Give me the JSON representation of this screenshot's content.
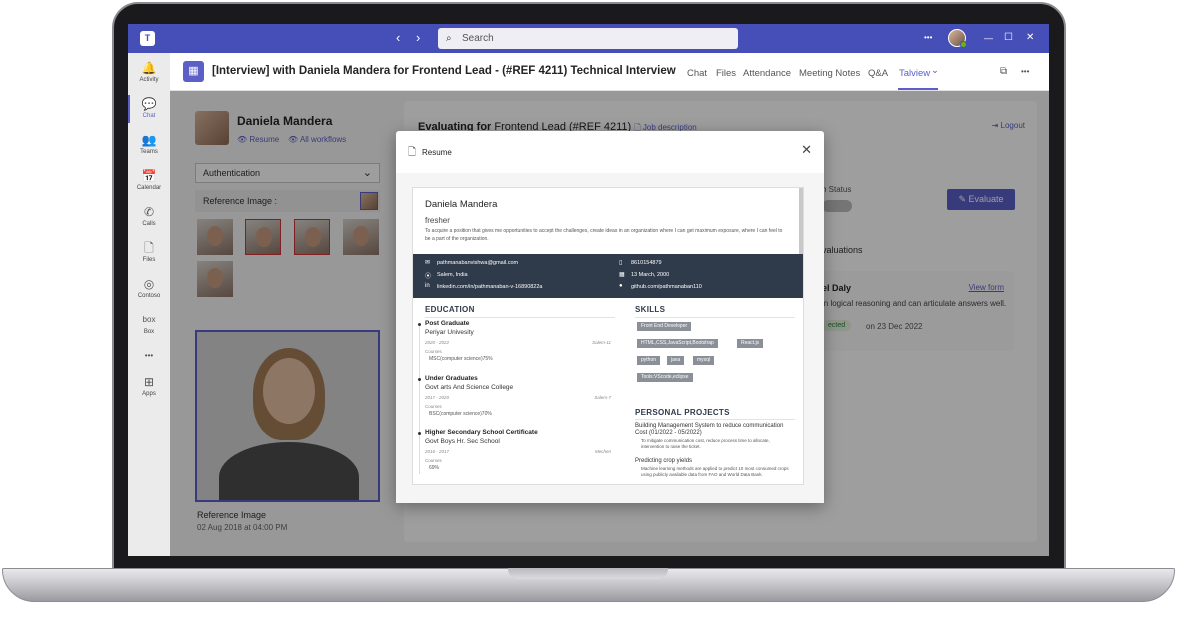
{
  "titlebar": {
    "search_placeholder": "Search",
    "more": "•••",
    "minimize": "—",
    "maximize": "☐",
    "close": "✕"
  },
  "rail": [
    {
      "label": "Activity",
      "icon": "bell-icon",
      "glyph": "🔔"
    },
    {
      "label": "Chat",
      "icon": "chat-icon",
      "glyph": "💬"
    },
    {
      "label": "Teams",
      "icon": "teams-icon",
      "glyph": "👥"
    },
    {
      "label": "Calendar",
      "icon": "calendar-icon",
      "glyph": "📅"
    },
    {
      "label": "Calls",
      "icon": "phone-icon",
      "glyph": "✆"
    },
    {
      "label": "Files",
      "icon": "file-icon",
      "glyph": "🗋"
    },
    {
      "label": "Contoso",
      "icon": "contoso-icon",
      "glyph": "◎"
    },
    {
      "label": "Box",
      "icon": "box-icon",
      "glyph": "box"
    },
    {
      "label": "",
      "icon": "more-icon",
      "glyph": "•••"
    },
    {
      "label": "Apps",
      "icon": "apps-icon",
      "glyph": "⊞"
    }
  ],
  "header": {
    "meeting_title": "[Interview] with Daniela Mandera for Frontend Lead - (#REF 4211) Technical Interview",
    "tabs": [
      "Chat",
      "Files",
      "Attendance",
      "Meeting Notes",
      "Q&A",
      "Talview"
    ],
    "active_tab": "Talview",
    "tab_chevron": "⌄",
    "more": "•••"
  },
  "candidate": {
    "name": "Daniela Mandera",
    "resume_link": "Resume",
    "workflows_link": "All workflows",
    "section_select": "Authentication",
    "reference_label": "Reference Image :",
    "reference_caption": "Reference Image",
    "reference_date": "02 Aug 2018 at 04:00 PM"
  },
  "evaluation": {
    "title_prefix": "Evaluating for",
    "title_role": "Frontend Lead (#REF 4211)",
    "job_description": "Job description",
    "logout": "Logout",
    "status_label": "n Status",
    "evaluate_button": "Evaluate",
    "evaluations_header": "valuations",
    "card": {
      "name": "el Daly",
      "view_form": "View form",
      "text": "in logical reasoning and can articulate answers well.",
      "status": "ected",
      "date": "on 23 Dec 2022"
    }
  },
  "modal": {
    "title": "Resume",
    "close": "✕"
  },
  "resume": {
    "name": "Daniela Mandera",
    "role": "fresher",
    "objective": "To acquire a position that gives me opportunities to accept the challenges, create ideas in an organization where I can get maximum exposure, where I can feel to be a part of the organization.",
    "contacts": {
      "email": "pathmanabanvishwa@gmail.com",
      "phone": "8610154879",
      "location": "Salem, India",
      "dob": "13 March, 2000",
      "linkedin": "linkedin.com/in/pathmanaban-v-16890822a",
      "github": "github.com/pathmanaban110"
    },
    "education_header": "EDUCATION",
    "education": [
      {
        "title": "Post Graduate",
        "school": "Periyar Univesity",
        "dates": "2020 - 2022",
        "location": "Salem-11",
        "courses_label": "Courses",
        "grade": "MSC(computer science)75%"
      },
      {
        "title": "Under Graduates",
        "school": "Govt arts And Science College",
        "dates": "2017 - 2020",
        "location": "Salem-7",
        "courses_label": "Courses",
        "grade": "BSC(computer science)70%"
      },
      {
        "title": "Higher Secondary School Certificate",
        "school": "Govt Boys Hr. Sec School",
        "dates": "2016 - 2017",
        "location": "Mecheri",
        "courses_label": "Courses",
        "grade": "69%"
      }
    ],
    "skills_header": "SKILLS",
    "skills": [
      "Front End Developer",
      "HTML,CSS,JavaScript,Bootstrap",
      "React.js",
      "python",
      "java",
      "mysql",
      "Tools:VScode,eclipse"
    ],
    "projects_header": "PERSONAL PROJECTS",
    "projects": [
      {
        "title": "Building Management System to reduce communication Cost (01/2022 - 05/2022)",
        "bullet": "To mitigate communication cost, reduce process time to allocate, intervention to raise the ticket."
      },
      {
        "title": "Predicting crop yields",
        "bullet": "Machine learning methods are applied to predict 10 most consumed crops using publicly available data from FAO and World Data Bank."
      }
    ]
  }
}
